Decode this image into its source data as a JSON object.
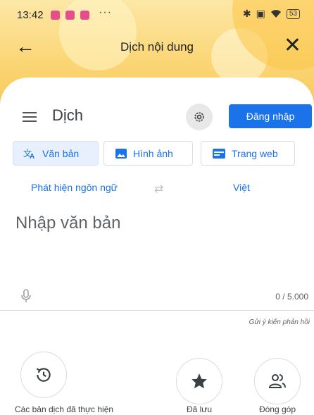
{
  "status_bar": {
    "time": "13:42",
    "more": "···",
    "battery": "53"
  },
  "toolbar": {
    "back_icon": "←",
    "title": "Dịch nội dung",
    "close_icon": "✕"
  },
  "header": {
    "app_title": "Dịch",
    "sign_in": "Đăng nhập"
  },
  "modes": [
    {
      "label": "Văn bản",
      "icon": "translate-icon",
      "active": true
    },
    {
      "label": "Hình ảnh",
      "icon": "image-icon",
      "active": false
    },
    {
      "label": "Trang web",
      "icon": "website-icon",
      "active": false
    }
  ],
  "languages": {
    "source": "Phát hiện ngôn ngữ",
    "swap_icon": "⇄",
    "target": "Việt"
  },
  "input": {
    "placeholder": "Nhập văn bản",
    "counter": "0 / 5.000"
  },
  "feedback": "Gửi ý kiến phản hồi",
  "bottom_actions": [
    {
      "label": "Các bản dịch đã thực hiện",
      "icon": "history-icon"
    },
    {
      "label": "Đã lưu",
      "icon": "star-icon"
    },
    {
      "label": "Đóng góp",
      "icon": "contribute-icon"
    }
  ],
  "colors": {
    "accent": "#1a73e8",
    "header_gradient_top": "#fce7a6",
    "header_gradient_bottom": "#f9c95a"
  }
}
